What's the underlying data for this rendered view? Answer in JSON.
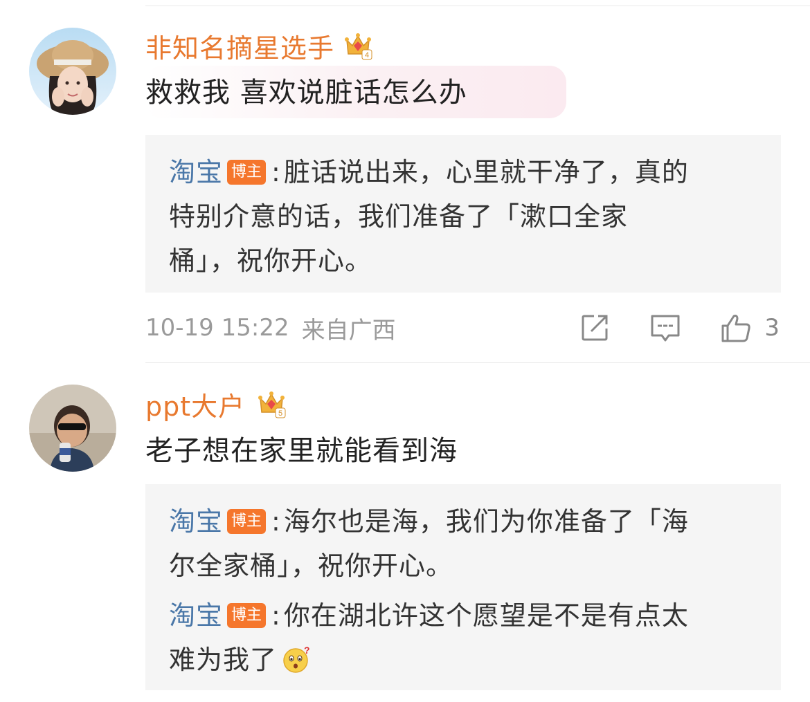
{
  "comments": [
    {
      "username": "非知名摘星选手",
      "crown_level": "4",
      "text": "救救我 喜欢说脏话怎么办",
      "replies": [
        {
          "name": "淘宝",
          "badge": "博主",
          "colon": ":",
          "lines": [
            "脏话说出来，心里就干净了，真的",
            "特别介意的话，我们准备了「漱口全家",
            "桶」，祝你开心。"
          ]
        }
      ],
      "timestamp": "10-19 15:22",
      "location": "来自广西",
      "likes": "3"
    },
    {
      "username": "ppt大户",
      "crown_level": "5",
      "text": "老子想在家里就能看到海",
      "replies": [
        {
          "name": "淘宝",
          "badge": "博主",
          "colon": ":",
          "lines": [
            "海尔也是海，我们为你准备了「海",
            "尔全家桶」，祝你开心。"
          ]
        },
        {
          "name": "淘宝",
          "badge": "博主",
          "colon": ":",
          "lines": [
            "你在湖北许这个愿望是不是有点太",
            "难为我了"
          ],
          "emoji": "surprised-face"
        }
      ]
    }
  ],
  "icons": {
    "share": "share-icon",
    "comment": "comment-icon",
    "like": "thumbs-up-icon"
  },
  "colors": {
    "username": "#e8792f",
    "reply_name": "#4a77a8",
    "badge": "#f5762c",
    "meta": "#9a9a9a"
  }
}
